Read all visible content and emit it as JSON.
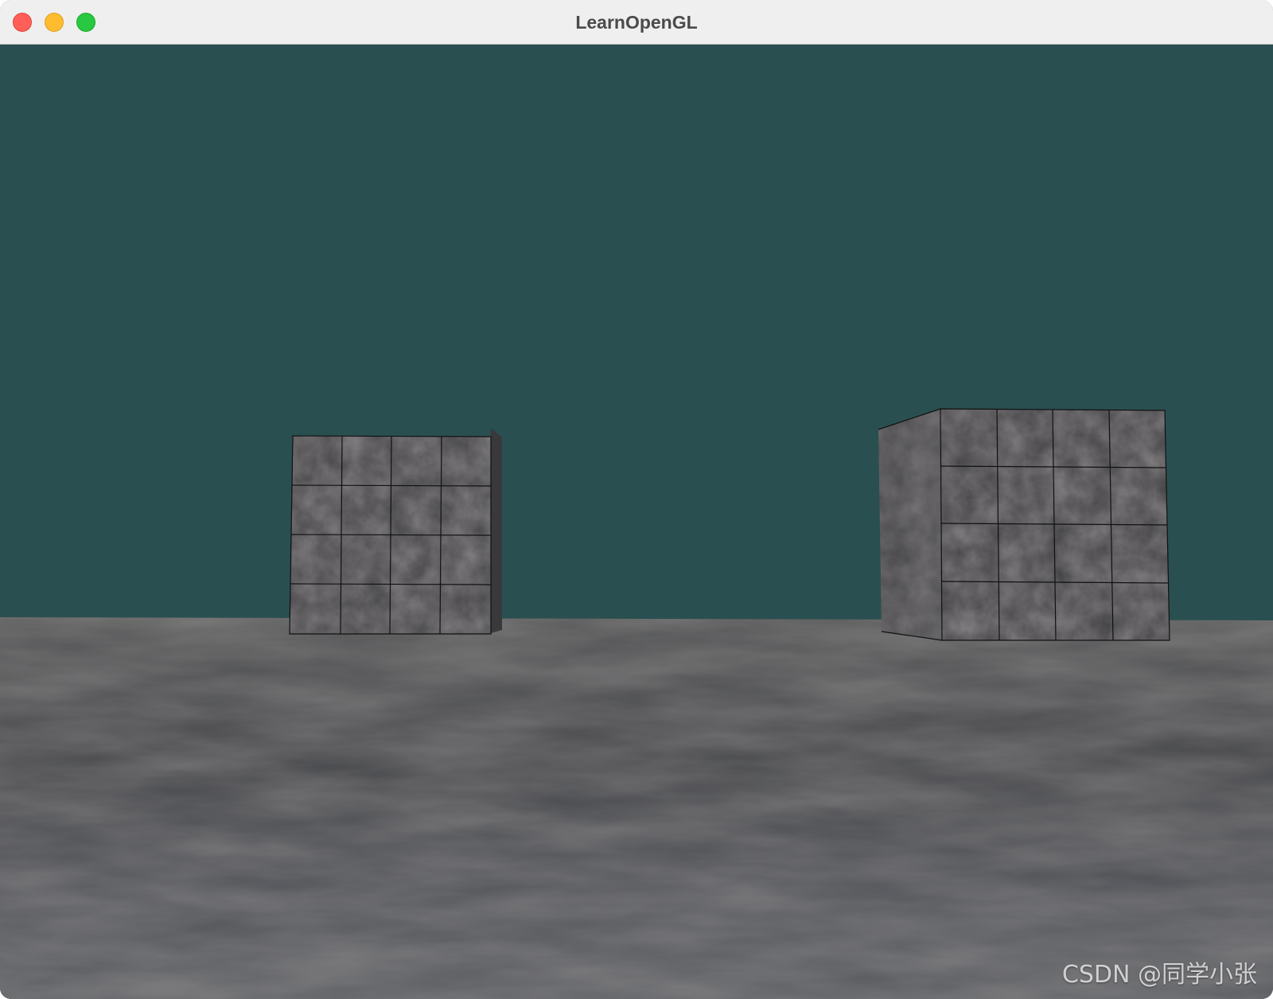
{
  "window": {
    "title": "LearnOpenGL"
  },
  "scene": {
    "sky_color": "#2a4f50",
    "floor_color": "#4e4f51",
    "cube_color": "#3b3a3c",
    "objects": [
      "marble-cube",
      "marble-cube",
      "stone-floor"
    ]
  },
  "watermark": {
    "text": "CSDN @同学小张"
  }
}
